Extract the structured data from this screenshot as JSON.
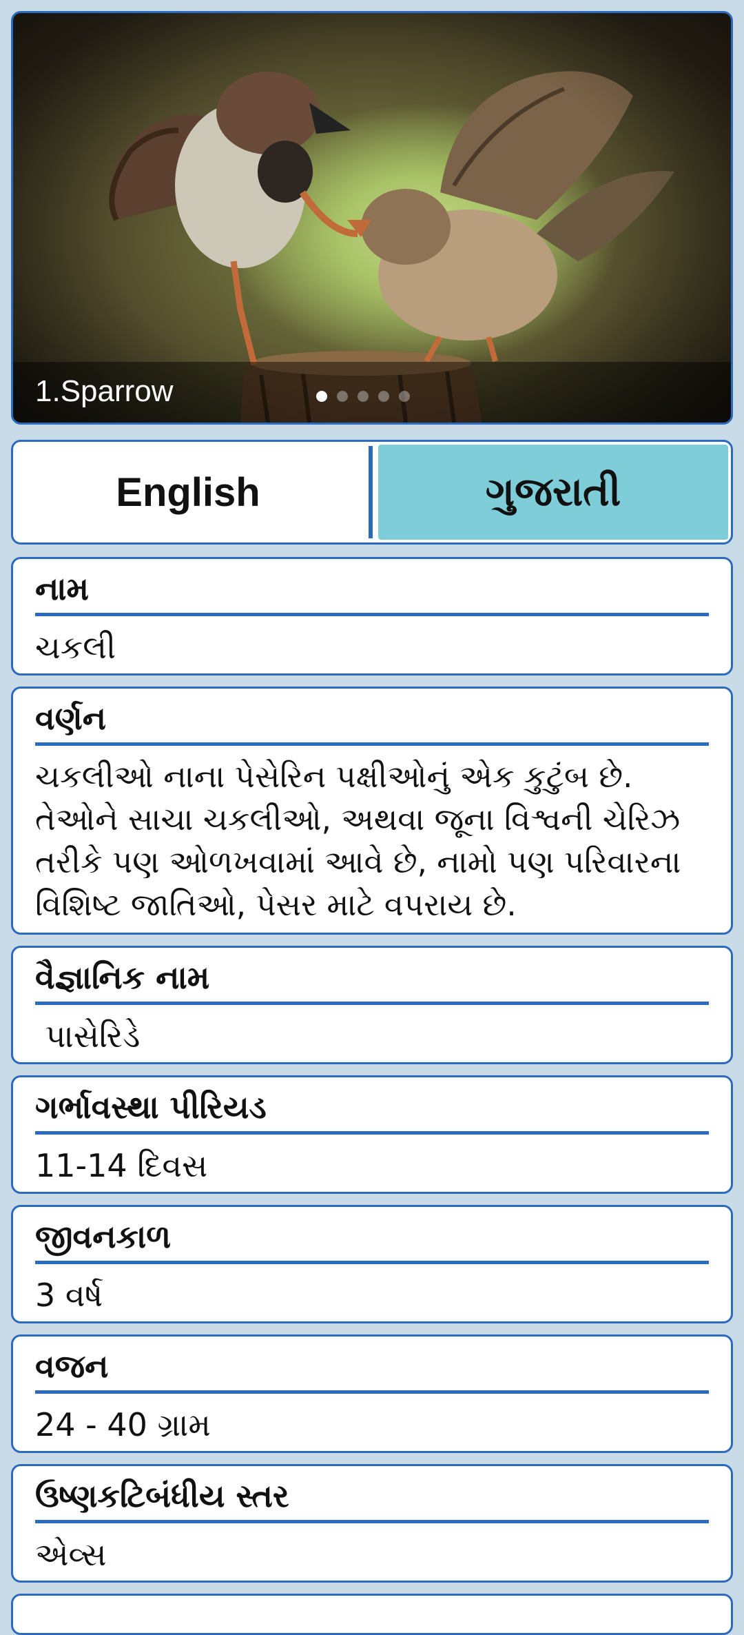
{
  "banner": {
    "caption": "1.Sparrow",
    "slides": 5,
    "active_slide": 1
  },
  "language_tabs": [
    {
      "label": "English",
      "selected": false
    },
    {
      "label": "ગુજરાતી",
      "selected": true
    }
  ],
  "details": [
    {
      "title": "નામ",
      "value": "ચકલી"
    },
    {
      "title": "વર્ણન",
      "value": "ચકલીઓ નાના પેસેરિન પક્ષીઓનું એક કુટુંબ છે. તેઓને સાચા ચકલીઓ, અથવા જૂના વિશ્વની ચેરિઝ તરીકે પણ ઓળખવામાં આવે છે, નામો પણ પરિવારના વિશિષ્ટ જાતિઓ, પેસર માટે વપરાય છે."
    },
    {
      "title": "વૈજ્ઞાનિક નામ",
      "value": " પાસેરિડે"
    },
    {
      "title": "ગર્ભાવસ્થા પીરિયડ",
      "value": "11-14 દિવસ"
    },
    {
      "title": "જીવનકાળ",
      "value": "3 વર્ષ"
    },
    {
      "title": "વજન",
      "value": "24 - 40 ગ્રામ"
    },
    {
      "title": "ઉષ્ણકટિબંધીય સ્તર",
      "value": "એવ્સ"
    }
  ],
  "colors": {
    "accent": "#2a6bbf",
    "selected_tab": "#7fcdd8",
    "background": "#c9dbe6"
  }
}
